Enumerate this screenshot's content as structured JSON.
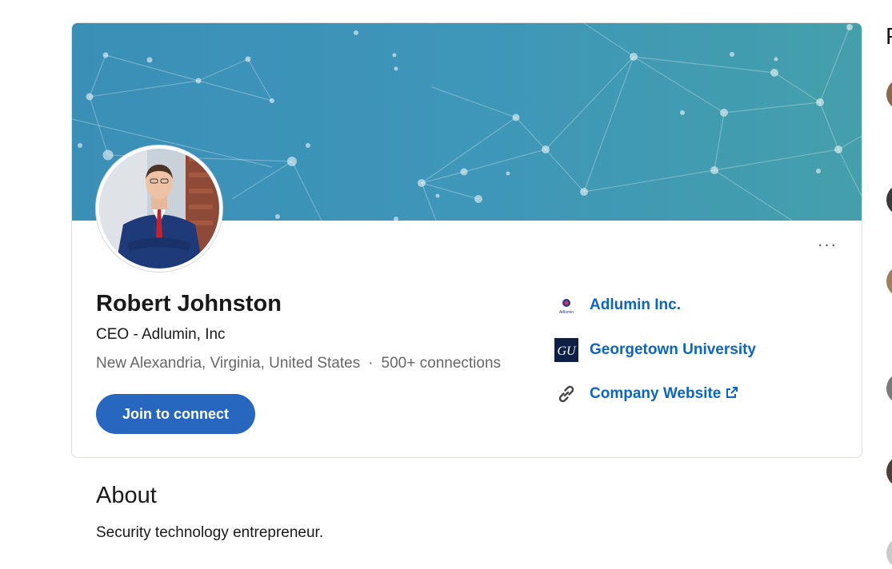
{
  "profile": {
    "name": "Robert Johnston",
    "headline": "CEO - Adlumin, Inc",
    "location": "New Alexandria, Virginia, United States",
    "separator": "·",
    "connections": "500+ connections",
    "join_button": "Join to connect",
    "more_label": "···"
  },
  "links": [
    {
      "label": "Adlumin Inc.",
      "icon": "adlumin-logo-icon",
      "logo_text": "Adlumin"
    },
    {
      "label": "Georgetown University",
      "icon": "georgetown-logo-icon",
      "logo_text": "GU"
    },
    {
      "label": "Company Website",
      "icon": "link-icon",
      "external": true
    }
  ],
  "about": {
    "title": "About",
    "text": "Security technology entrepreneur."
  },
  "sidebar": {
    "heading_fragment": "P"
  },
  "colors": {
    "link_blue": "#0a66c2",
    "button_blue": "#2867c0",
    "banner_start": "#3a8fb7",
    "banner_end": "#449fab"
  }
}
